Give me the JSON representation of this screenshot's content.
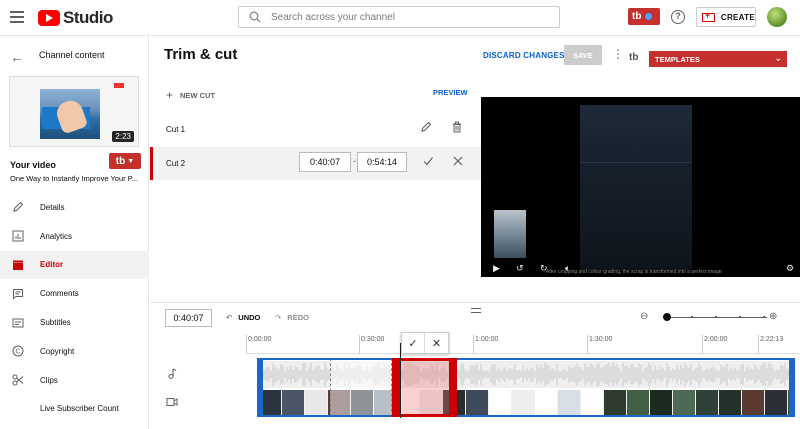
{
  "header": {
    "logo_text": "Studio",
    "search_placeholder": "Search across your channel",
    "tb_badge": "tb",
    "help_icon": "?",
    "create_label": "CREATE"
  },
  "sidebar": {
    "back_label": "Channel content",
    "thumbnail_duration": "2:23",
    "your_video_label": "Your video",
    "video_title": "One Way to Instantly Improve Your P...",
    "tb_button": "tb",
    "items": [
      {
        "label": "Details",
        "icon": "pencil-icon",
        "active": false
      },
      {
        "label": "Analytics",
        "icon": "analytics-icon",
        "active": false
      },
      {
        "label": "Editor",
        "icon": "clapper-icon",
        "active": true
      },
      {
        "label": "Comments",
        "icon": "comment-icon",
        "active": false
      },
      {
        "label": "Subtitles",
        "icon": "subtitles-icon",
        "active": false
      },
      {
        "label": "Copyright",
        "icon": "copyright-icon",
        "active": false
      },
      {
        "label": "Clips",
        "icon": "scissors-icon",
        "active": false
      },
      {
        "label": "Live Subscriber Count",
        "icon": "",
        "active": false
      }
    ]
  },
  "main": {
    "title": "Trim & cut",
    "discard_label": "DISCARD CHANGES",
    "save_label": "SAVE",
    "tb_mark": "tb",
    "templates_label": "TEMPLATES",
    "new_cut_label": "NEW CUT",
    "preview_label": "PREVIEW",
    "cuts": [
      {
        "name": "Cut 1"
      },
      {
        "name": "Cut 2",
        "start": "0:40:07",
        "end": "0:54:14"
      }
    ],
    "player_caption": "After cropping and colour grading, the scrap is transformed into a perfect image"
  },
  "timeline": {
    "current_time": "0:40:07",
    "undo_label": "UNDO",
    "redo_label": "REDO",
    "ruler": [
      "0:00:00",
      "0:30:00",
      "1:00:00",
      "1:30:00",
      "2:00:00",
      "2:22:13"
    ]
  },
  "colors": {
    "accent_red": "#c4302b",
    "link_blue": "#065fd4",
    "selection_blue": "#1a66c9"
  }
}
